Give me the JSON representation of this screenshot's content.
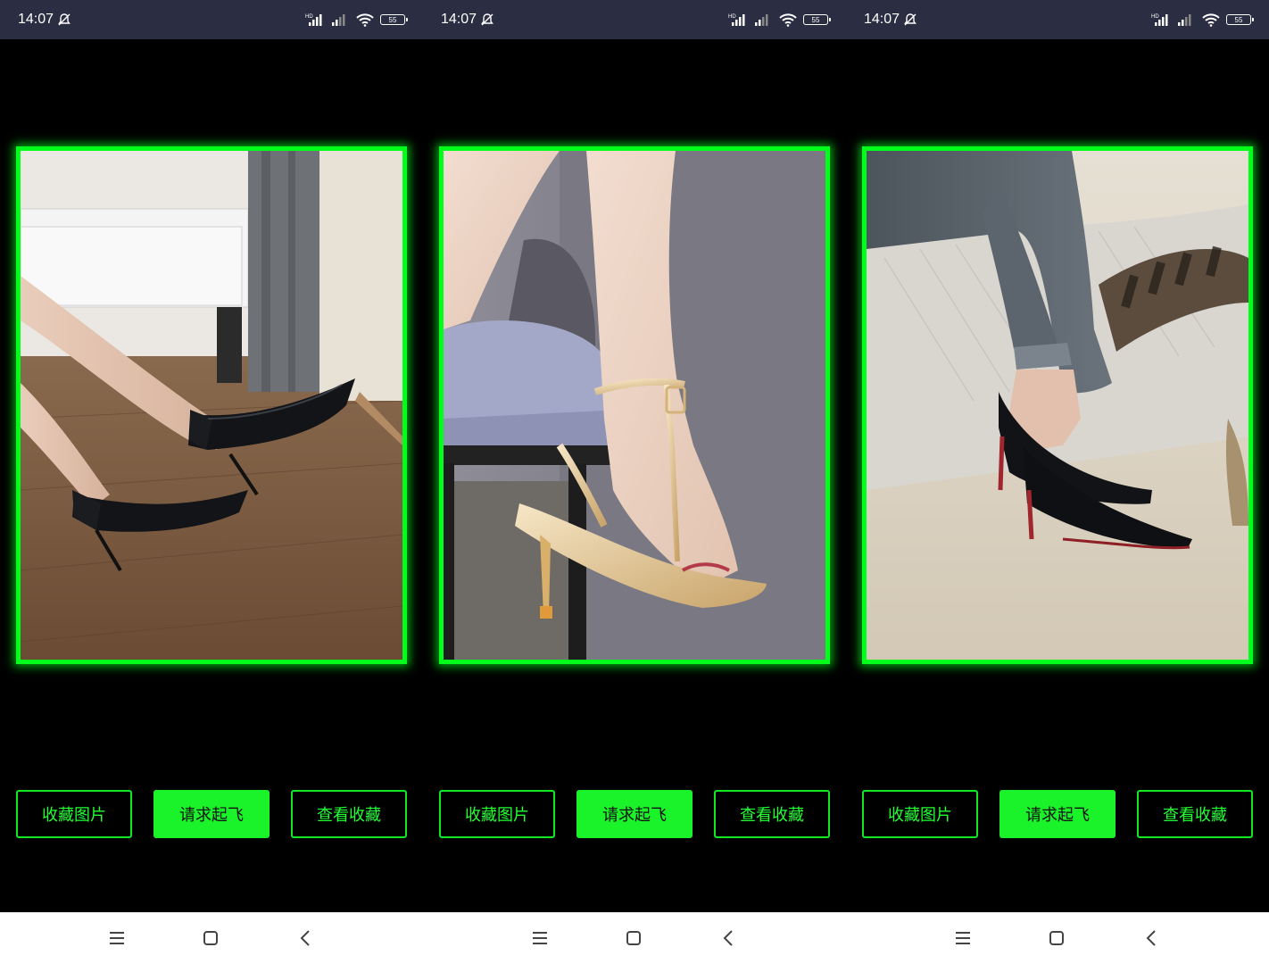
{
  "screens": [
    {
      "status": {
        "time": "14:07",
        "battery": "55"
      },
      "photo": {
        "subject": "black patent pumps on wooden floor"
      },
      "buttons": {
        "favorite": "收藏图片",
        "takeoff": "请求起飞",
        "view_favorites": "查看收藏"
      }
    },
    {
      "status": {
        "time": "14:07",
        "battery": "55"
      },
      "photo": {
        "subject": "gold strappy sandal on chair"
      },
      "buttons": {
        "favorite": "收藏图片",
        "takeoff": "请求起飞",
        "view_favorites": "查看收藏"
      }
    },
    {
      "status": {
        "time": "14:07",
        "battery": "55"
      },
      "photo": {
        "subject": "black pumps with red soles on carpet"
      },
      "buttons": {
        "favorite": "收藏图片",
        "takeoff": "请求起飞",
        "view_favorites": "查看收藏"
      }
    }
  ],
  "colors": {
    "accent": "#00ff1a",
    "button_fill": "#1af22a",
    "status_bar": "#2b2d42",
    "nav_bar": "#ffffff"
  },
  "icons": {
    "status": [
      "mute-icon",
      "hd-signal-icon",
      "signal-icon",
      "wifi-icon",
      "battery-icon"
    ],
    "nav": [
      "menu-icon",
      "home-icon",
      "back-icon"
    ]
  }
}
